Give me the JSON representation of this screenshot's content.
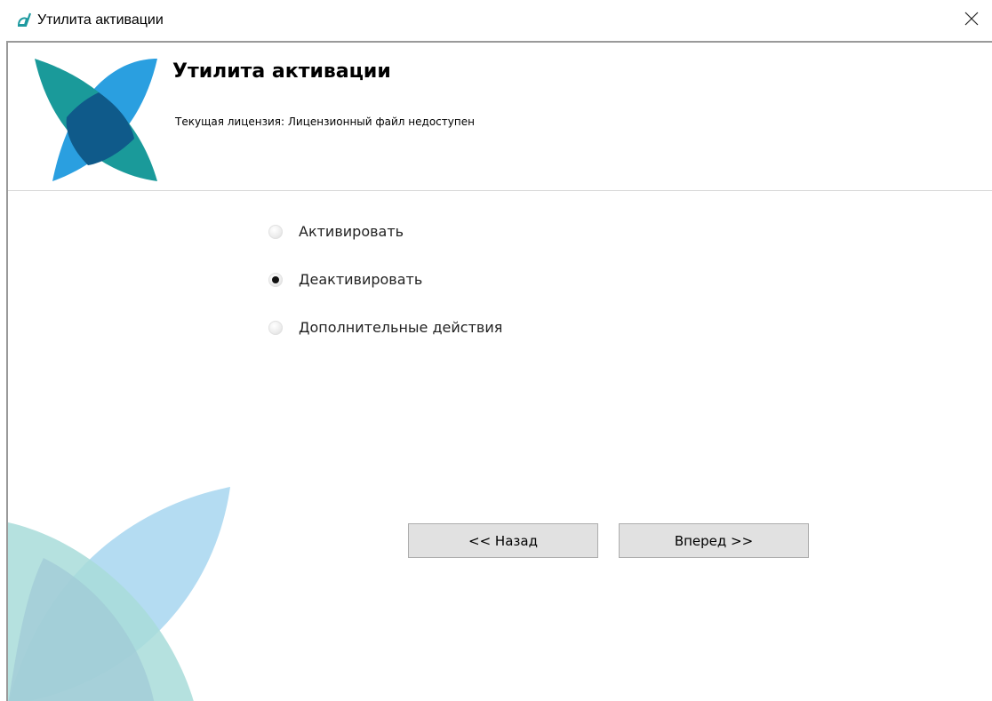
{
  "window": {
    "title": "Утилита активации",
    "icon": "app-logo-icon",
    "close_icon": "close-icon"
  },
  "header": {
    "title": "Утилита активации",
    "license_label": "Текущая лицензия: Лицензионный файл недоступен"
  },
  "options": [
    {
      "label": "Активировать",
      "checked": false
    },
    {
      "label": "Деактивировать",
      "checked": true
    },
    {
      "label": "Дополнительные действия",
      "checked": false
    }
  ],
  "buttons": {
    "back_label": "<< Назад",
    "next_label": "Вперед >>"
  },
  "colors": {
    "logo_teal": "#1a9a9a",
    "logo_blue": "#2a9fe0",
    "logo_dark": "#0f5a8a",
    "art_teal": "#a8dcd9",
    "art_blue": "#b4dcf2",
    "button_bg": "#e1e1e1"
  }
}
